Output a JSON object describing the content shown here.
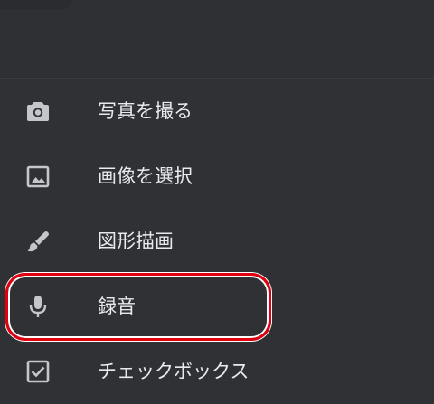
{
  "menu": {
    "items": [
      {
        "label": "写真を撮る",
        "icon": "camera-icon"
      },
      {
        "label": "画像を選択",
        "icon": "image-icon"
      },
      {
        "label": "図形描画",
        "icon": "brush-icon"
      },
      {
        "label": "録音",
        "icon": "microphone-icon"
      },
      {
        "label": "チェックボックス",
        "icon": "checkbox-icon"
      }
    ]
  },
  "colors": {
    "background": "#303134",
    "text": "#e8eaed",
    "icon": "#c5c6c9",
    "highlight": "#e0000f"
  }
}
